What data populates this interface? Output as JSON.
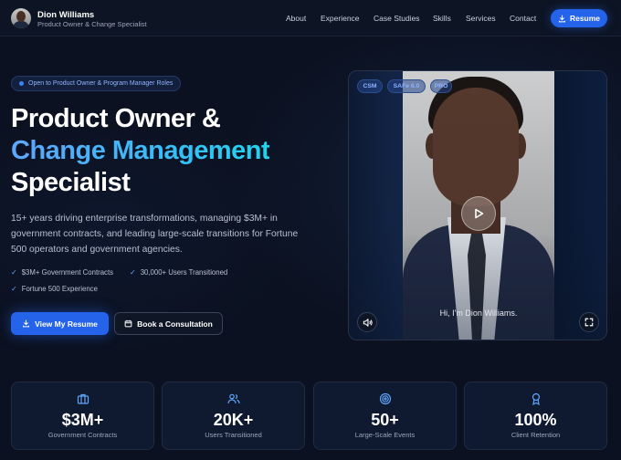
{
  "header": {
    "name": "Dion Williams",
    "title": "Product Owner & Change Specialist",
    "nav": [
      "About",
      "Experience",
      "Case Studies",
      "Skills",
      "Services",
      "Contact"
    ],
    "resume_label": "Resume"
  },
  "hero": {
    "pill": "Open to Product Owner & Program Manager Roles",
    "heading_line1": "Product Owner &",
    "heading_line2": "Change Management",
    "heading_line3": "Specialist",
    "lead": "15+ years driving enterprise transformations, managing $3M+ in government contracts, and leading large-scale transitions for Fortune 500 operators and government agencies.",
    "checks": [
      "$3M+ Government Contracts",
      "30,000+ Users Transitioned",
      "Fortune 500 Experience"
    ],
    "primary_cta": "View My Resume",
    "secondary_cta": "Book a Consultation"
  },
  "video": {
    "badges": [
      "CSM",
      "SAFe 6.0",
      "PRO"
    ],
    "caption": "Hi, I'm Dion Williams."
  },
  "stats": [
    {
      "value": "$3M+",
      "label": "Government Contracts",
      "icon": "briefcase-icon"
    },
    {
      "value": "20K+",
      "label": "Users Transitioned",
      "icon": "users-icon"
    },
    {
      "value": "50+",
      "label": "Large-Scale Events",
      "icon": "target-icon"
    },
    {
      "value": "100%",
      "label": "Client Retention",
      "icon": "award-icon"
    }
  ],
  "colors": {
    "accent": "#2563eb",
    "background": "#0b1120",
    "heading_gradient": "#38bdf8"
  }
}
